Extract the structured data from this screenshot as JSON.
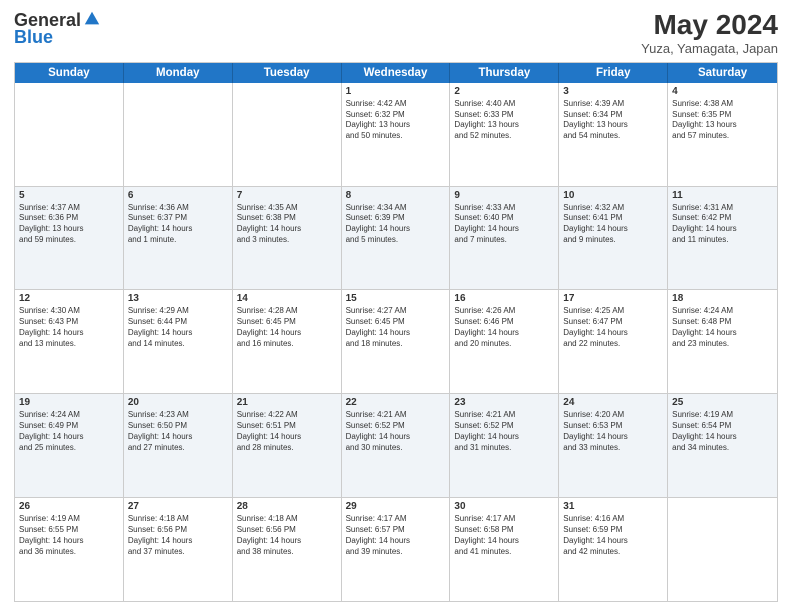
{
  "logo": {
    "general": "General",
    "blue": "Blue"
  },
  "header": {
    "title": "May 2024",
    "location": "Yuza, Yamagata, Japan"
  },
  "weekdays": [
    "Sunday",
    "Monday",
    "Tuesday",
    "Wednesday",
    "Thursday",
    "Friday",
    "Saturday"
  ],
  "rows": [
    {
      "alt": false,
      "cells": [
        {
          "day": "",
          "info": ""
        },
        {
          "day": "",
          "info": ""
        },
        {
          "day": "",
          "info": ""
        },
        {
          "day": "1",
          "info": "Sunrise: 4:42 AM\nSunset: 6:32 PM\nDaylight: 13 hours\nand 50 minutes."
        },
        {
          "day": "2",
          "info": "Sunrise: 4:40 AM\nSunset: 6:33 PM\nDaylight: 13 hours\nand 52 minutes."
        },
        {
          "day": "3",
          "info": "Sunrise: 4:39 AM\nSunset: 6:34 PM\nDaylight: 13 hours\nand 54 minutes."
        },
        {
          "day": "4",
          "info": "Sunrise: 4:38 AM\nSunset: 6:35 PM\nDaylight: 13 hours\nand 57 minutes."
        }
      ]
    },
    {
      "alt": true,
      "cells": [
        {
          "day": "5",
          "info": "Sunrise: 4:37 AM\nSunset: 6:36 PM\nDaylight: 13 hours\nand 59 minutes."
        },
        {
          "day": "6",
          "info": "Sunrise: 4:36 AM\nSunset: 6:37 PM\nDaylight: 14 hours\nand 1 minute."
        },
        {
          "day": "7",
          "info": "Sunrise: 4:35 AM\nSunset: 6:38 PM\nDaylight: 14 hours\nand 3 minutes."
        },
        {
          "day": "8",
          "info": "Sunrise: 4:34 AM\nSunset: 6:39 PM\nDaylight: 14 hours\nand 5 minutes."
        },
        {
          "day": "9",
          "info": "Sunrise: 4:33 AM\nSunset: 6:40 PM\nDaylight: 14 hours\nand 7 minutes."
        },
        {
          "day": "10",
          "info": "Sunrise: 4:32 AM\nSunset: 6:41 PM\nDaylight: 14 hours\nand 9 minutes."
        },
        {
          "day": "11",
          "info": "Sunrise: 4:31 AM\nSunset: 6:42 PM\nDaylight: 14 hours\nand 11 minutes."
        }
      ]
    },
    {
      "alt": false,
      "cells": [
        {
          "day": "12",
          "info": "Sunrise: 4:30 AM\nSunset: 6:43 PM\nDaylight: 14 hours\nand 13 minutes."
        },
        {
          "day": "13",
          "info": "Sunrise: 4:29 AM\nSunset: 6:44 PM\nDaylight: 14 hours\nand 14 minutes."
        },
        {
          "day": "14",
          "info": "Sunrise: 4:28 AM\nSunset: 6:45 PM\nDaylight: 14 hours\nand 16 minutes."
        },
        {
          "day": "15",
          "info": "Sunrise: 4:27 AM\nSunset: 6:45 PM\nDaylight: 14 hours\nand 18 minutes."
        },
        {
          "day": "16",
          "info": "Sunrise: 4:26 AM\nSunset: 6:46 PM\nDaylight: 14 hours\nand 20 minutes."
        },
        {
          "day": "17",
          "info": "Sunrise: 4:25 AM\nSunset: 6:47 PM\nDaylight: 14 hours\nand 22 minutes."
        },
        {
          "day": "18",
          "info": "Sunrise: 4:24 AM\nSunset: 6:48 PM\nDaylight: 14 hours\nand 23 minutes."
        }
      ]
    },
    {
      "alt": true,
      "cells": [
        {
          "day": "19",
          "info": "Sunrise: 4:24 AM\nSunset: 6:49 PM\nDaylight: 14 hours\nand 25 minutes."
        },
        {
          "day": "20",
          "info": "Sunrise: 4:23 AM\nSunset: 6:50 PM\nDaylight: 14 hours\nand 27 minutes."
        },
        {
          "day": "21",
          "info": "Sunrise: 4:22 AM\nSunset: 6:51 PM\nDaylight: 14 hours\nand 28 minutes."
        },
        {
          "day": "22",
          "info": "Sunrise: 4:21 AM\nSunset: 6:52 PM\nDaylight: 14 hours\nand 30 minutes."
        },
        {
          "day": "23",
          "info": "Sunrise: 4:21 AM\nSunset: 6:52 PM\nDaylight: 14 hours\nand 31 minutes."
        },
        {
          "day": "24",
          "info": "Sunrise: 4:20 AM\nSunset: 6:53 PM\nDaylight: 14 hours\nand 33 minutes."
        },
        {
          "day": "25",
          "info": "Sunrise: 4:19 AM\nSunset: 6:54 PM\nDaylight: 14 hours\nand 34 minutes."
        }
      ]
    },
    {
      "alt": false,
      "cells": [
        {
          "day": "26",
          "info": "Sunrise: 4:19 AM\nSunset: 6:55 PM\nDaylight: 14 hours\nand 36 minutes."
        },
        {
          "day": "27",
          "info": "Sunrise: 4:18 AM\nSunset: 6:56 PM\nDaylight: 14 hours\nand 37 minutes."
        },
        {
          "day": "28",
          "info": "Sunrise: 4:18 AM\nSunset: 6:56 PM\nDaylight: 14 hours\nand 38 minutes."
        },
        {
          "day": "29",
          "info": "Sunrise: 4:17 AM\nSunset: 6:57 PM\nDaylight: 14 hours\nand 39 minutes."
        },
        {
          "day": "30",
          "info": "Sunrise: 4:17 AM\nSunset: 6:58 PM\nDaylight: 14 hours\nand 41 minutes."
        },
        {
          "day": "31",
          "info": "Sunrise: 4:16 AM\nSunset: 6:59 PM\nDaylight: 14 hours\nand 42 minutes."
        },
        {
          "day": "",
          "info": ""
        }
      ]
    }
  ]
}
